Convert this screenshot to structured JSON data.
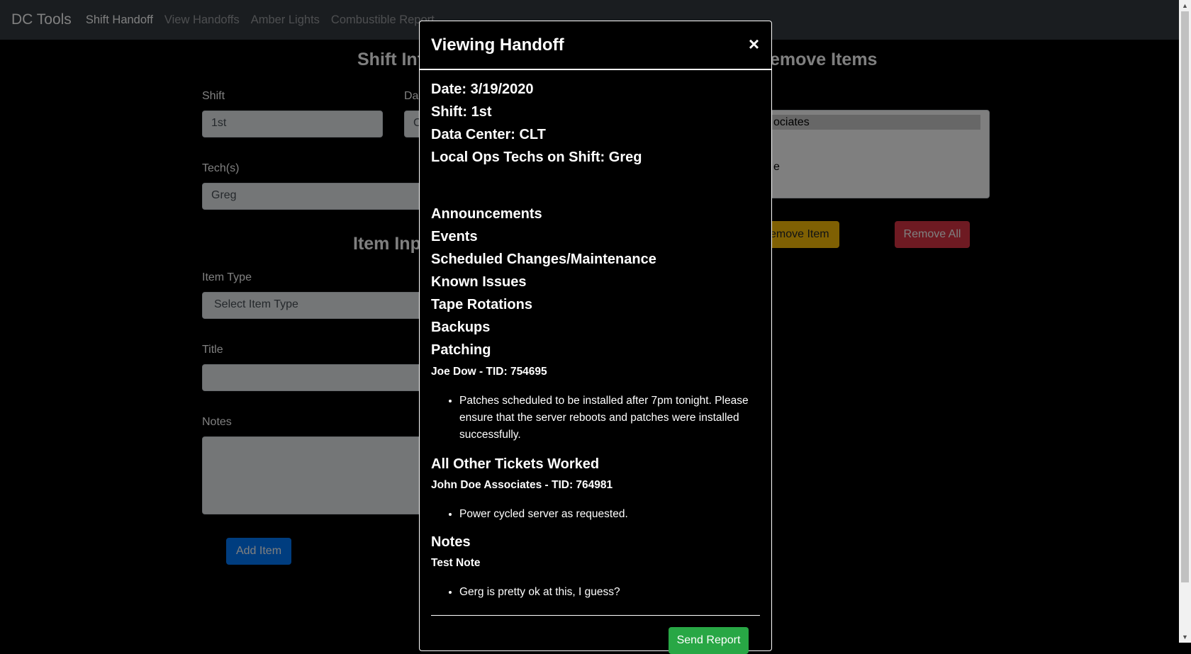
{
  "navbar": {
    "brand": "DC Tools",
    "links": [
      "Shift Handoff",
      "View Handoffs",
      "Amber Lights",
      "Combustible Report"
    ]
  },
  "page": {
    "shift_info_heading": "Shift Inf",
    "remove_items_heading": "emove Items",
    "item_input_heading": "Item Inp",
    "shift_label": "Shift",
    "shift_value": "1st",
    "date_label": "Da",
    "date_value_partial": "C",
    "techs_label": "Tech(s)",
    "techs_value": "Greg",
    "item_type_label": "Item Type",
    "item_type_value": "Select Item Type",
    "title_label": "Title",
    "notes_label": "Notes",
    "add_item_button": "Add Item",
    "remove_item_button": "emove Item",
    "remove_all_button": "Remove All",
    "list_option_1": "ociates",
    "list_option_2": "e"
  },
  "modal": {
    "title": "Viewing Handoff",
    "close": "×",
    "date_line": "Date: 3/19/2020",
    "shift_line": "Shift: 1st",
    "dc_line": "Data Center: CLT",
    "techs_line": "Local Ops Techs on Shift: Greg",
    "sections": {
      "announcements": "Announcements",
      "events": "Events",
      "scheduled": "Scheduled Changes/Maintenance",
      "known_issues": "Known Issues",
      "tape_rotations": "Tape Rotations",
      "backups": "Backups",
      "patching": "Patching",
      "other_tickets": "All Other Tickets Worked",
      "notes": "Notes"
    },
    "patching_entry": {
      "title": "Joe Dow - TID: 754695",
      "note": "Patches scheduled to be installed after 7pm tonight. Please ensure that the server reboots and patches were installed successfully."
    },
    "other_entry": {
      "title": "John Doe Associates - TID: 764981",
      "note": "Power cycled server as requested."
    },
    "notes_entry": {
      "title": "Test Note",
      "note": "Gerg is pretty ok at this, I guess?"
    },
    "send_button": "Send Report"
  },
  "colors": {
    "navbar_bg": "#343a40",
    "primary": "#007bff",
    "warning": "#ffc107",
    "danger": "#dc3545",
    "success": "#28a745"
  }
}
